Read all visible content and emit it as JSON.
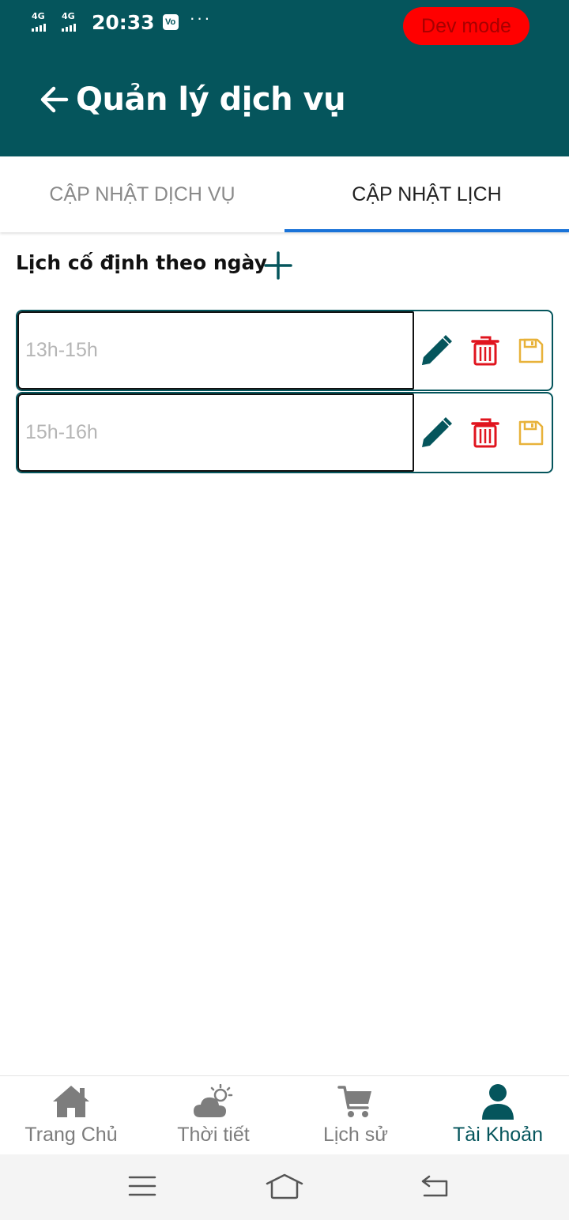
{
  "status_bar": {
    "network_1": "4G",
    "network_2": "4G",
    "time": "20:33",
    "notification_glyph": "Vo",
    "more": "···"
  },
  "dev_badge": "Dev mode",
  "header": {
    "title": "Quản lý dịch vụ"
  },
  "tabs": [
    {
      "label": "CẬP NHẬT DỊCH VỤ",
      "active": false
    },
    {
      "label": "CẬP NHẬT LỊCH",
      "active": true
    }
  ],
  "section": {
    "title": "Lịch cố định theo ngày"
  },
  "schedule_rows": [
    {
      "placeholder": "13h-15h"
    },
    {
      "placeholder": "15h-16h"
    }
  ],
  "bottom_nav": [
    {
      "label": "Trang Chủ",
      "icon": "home-icon",
      "active": false
    },
    {
      "label": "Thời tiết",
      "icon": "weather-icon",
      "active": false
    },
    {
      "label": "Lịch sử",
      "icon": "cart-icon",
      "active": false
    },
    {
      "label": "Tài Khoản",
      "icon": "user-icon",
      "active": true
    }
  ],
  "colors": {
    "header_bg": "#05555c",
    "accent_tab": "#1a73d8",
    "edit": "#05555c",
    "delete": "#e0141e",
    "save": "#e8b23a",
    "dev_badge": "#ff0000",
    "nav_inactive": "#7d7d7d"
  }
}
